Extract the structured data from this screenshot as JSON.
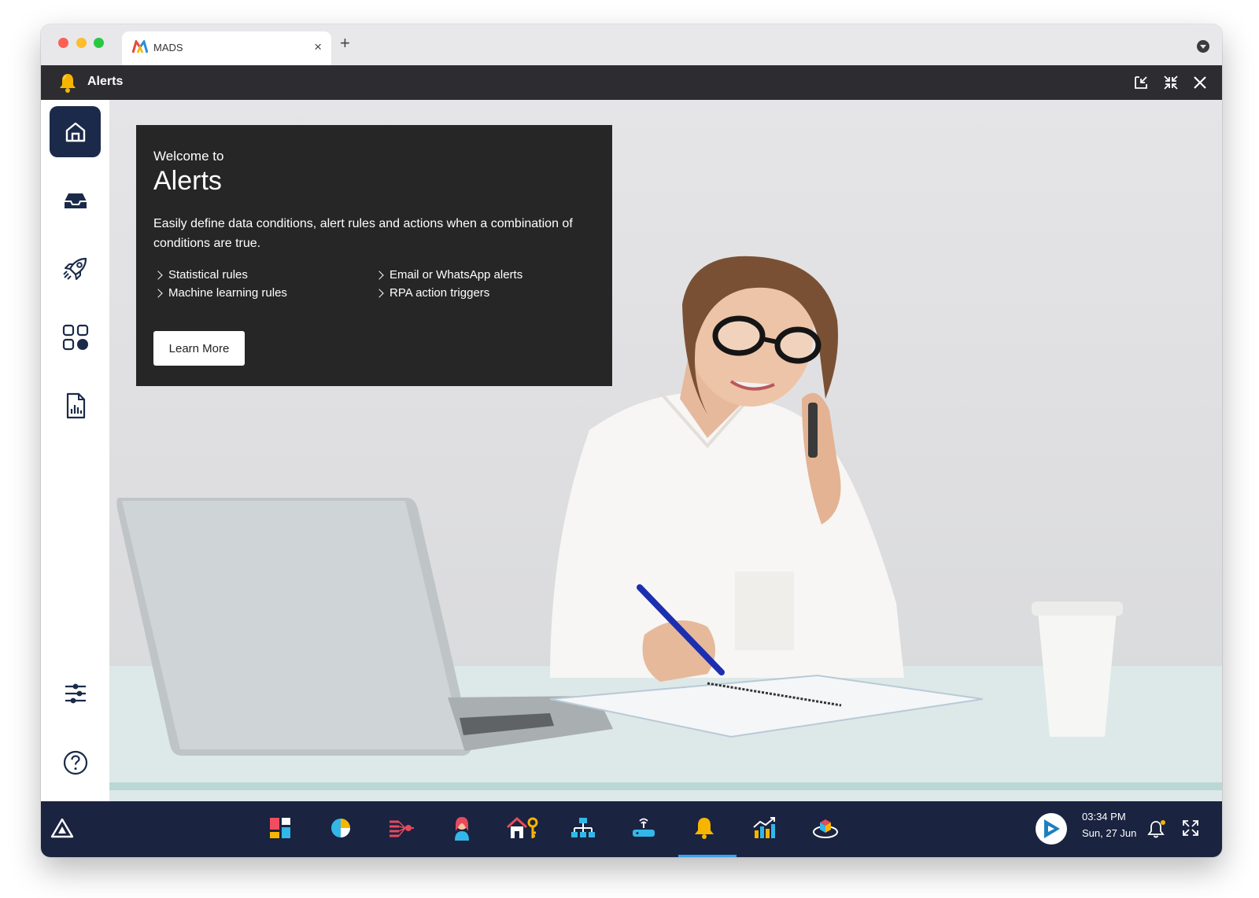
{
  "browser": {
    "tab_title": "MADS",
    "tab_close": "×",
    "new_tab": "+"
  },
  "app": {
    "title": "Alerts"
  },
  "sidebar": {
    "items": [
      {
        "icon": "home-icon",
        "active": true
      },
      {
        "icon": "inbox-icon",
        "active": false
      },
      {
        "icon": "rocket-icon",
        "active": false
      },
      {
        "icon": "apps-grid-icon",
        "active": false
      },
      {
        "icon": "report-document-icon",
        "active": false
      }
    ],
    "bottom": [
      {
        "icon": "sliders-icon"
      },
      {
        "icon": "help-icon"
      }
    ]
  },
  "welcome": {
    "small": "Welcome to",
    "big": "Alerts",
    "description": "Easily define data conditions, alert rules and actions when a combination of conditions are true.",
    "features_left": [
      "Statistical rules",
      "Machine learning rules"
    ],
    "features_right": [
      "Email or WhatsApp alerts",
      "RPA action triggers"
    ],
    "button": "Learn More"
  },
  "taskbar": {
    "apps": [
      "dashboard-icon",
      "pie-chart-icon",
      "data-flow-icon",
      "person-icon",
      "house-key-icon",
      "org-chart-icon",
      "router-icon",
      "bell-icon",
      "growth-chart-icon",
      "cube-icon"
    ],
    "active_app": "bell-icon",
    "time": "03:34 PM",
    "date": "Sun, 27 Jun"
  },
  "colors": {
    "appbar": "#2c2c31",
    "sidebar_active": "#1b2a4a",
    "taskbar": "#1a2340",
    "welcome_panel": "#262626",
    "accent": "#3ea0e6",
    "bell": "#f7b500"
  }
}
